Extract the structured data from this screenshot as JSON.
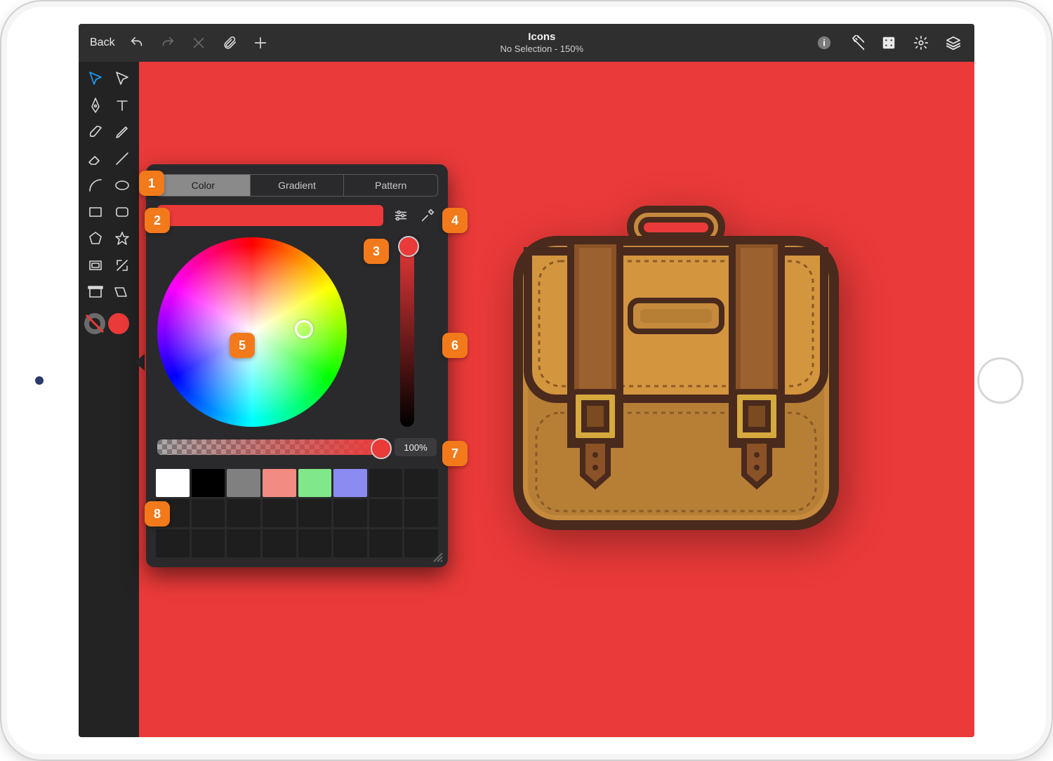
{
  "header": {
    "back_label": "Back",
    "title": "Icons",
    "subtitle": "No Selection - 150%"
  },
  "tabs": {
    "color": "Color",
    "gradient": "Gradient",
    "pattern": "Pattern",
    "active": "color"
  },
  "current_color": "#ea3a39",
  "opacity_label": "100%",
  "swatches": [
    "#ffffff",
    "#000000",
    "#808080",
    "#f28b82",
    "#81e78b",
    "#8b8bf2"
  ],
  "callouts": [
    "1",
    "2",
    "3",
    "4",
    "5",
    "6",
    "7",
    "8"
  ],
  "tools": [
    "select",
    "direct-select",
    "pen",
    "text",
    "brush",
    "pencil",
    "eraser",
    "line",
    "arc",
    "ellipse",
    "rectangle",
    "rounded-rect",
    "polygon",
    "star",
    "frame",
    "transform",
    "artboard",
    "shear"
  ]
}
